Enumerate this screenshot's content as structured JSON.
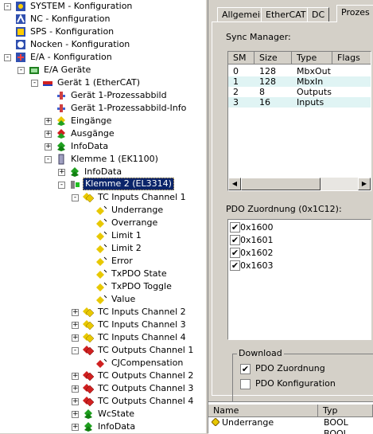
{
  "tree": [
    {
      "level": 0,
      "exp": "-",
      "icon": "system-icon",
      "label": "SYSTEM - Konfiguration"
    },
    {
      "level": 0,
      "exp": "",
      "icon": "nc-icon",
      "label": "NC - Konfiguration"
    },
    {
      "level": 0,
      "exp": "",
      "icon": "sps-icon",
      "label": "SPS - Konfiguration"
    },
    {
      "level": 0,
      "exp": "",
      "icon": "cam-icon",
      "label": "Nocken - Konfiguration"
    },
    {
      "level": 0,
      "exp": "-",
      "icon": "io-config-icon",
      "label": "E/A - Konfiguration"
    },
    {
      "level": 1,
      "exp": "-",
      "icon": "io-devices-icon",
      "label": "E/A Geräte"
    },
    {
      "level": 2,
      "exp": "-",
      "icon": "ethercat-device-icon",
      "label": "Gerät 1 (EtherCAT)"
    },
    {
      "level": 3,
      "exp": "",
      "icon": "process-image-icon",
      "label": "Gerät 1-Prozessabbild"
    },
    {
      "level": 3,
      "exp": "",
      "icon": "process-image-icon",
      "label": "Gerät 1-Prozessabbild-Info"
    },
    {
      "level": 3,
      "exp": "+",
      "icon": "inputs-icon",
      "label": "Eingänge"
    },
    {
      "level": 3,
      "exp": "+",
      "icon": "outputs-icon",
      "label": "Ausgänge"
    },
    {
      "level": 3,
      "exp": "+",
      "icon": "infodata-icon",
      "label": "InfoData"
    },
    {
      "level": 3,
      "exp": "-",
      "icon": "terminal-icon",
      "label": "Klemme 1 (EK1100)"
    },
    {
      "level": 4,
      "exp": "+",
      "icon": "infodata-icon",
      "label": "InfoData"
    },
    {
      "level": 4,
      "exp": "-",
      "icon": "module-icon",
      "label": "Klemme 2 (EL3314)",
      "selected": true
    },
    {
      "level": 5,
      "exp": "-",
      "icon": "input-var-icon",
      "label": "TC Inputs Channel 1"
    },
    {
      "level": 6,
      "exp": "",
      "icon": "var-in-icon",
      "label": "Underrange"
    },
    {
      "level": 6,
      "exp": "",
      "icon": "var-in-icon",
      "label": "Overrange"
    },
    {
      "level": 6,
      "exp": "",
      "icon": "var-in-icon",
      "label": "Limit 1"
    },
    {
      "level": 6,
      "exp": "",
      "icon": "var-in-icon",
      "label": "Limit 2"
    },
    {
      "level": 6,
      "exp": "",
      "icon": "var-in-icon",
      "label": "Error"
    },
    {
      "level": 6,
      "exp": "",
      "icon": "var-in-icon",
      "label": "TxPDO State"
    },
    {
      "level": 6,
      "exp": "",
      "icon": "var-in-icon",
      "label": "TxPDO Toggle"
    },
    {
      "level": 6,
      "exp": "",
      "icon": "var-in-icon",
      "label": "Value"
    },
    {
      "level": 5,
      "exp": "+",
      "icon": "input-var-icon",
      "label": "TC Inputs Channel 2"
    },
    {
      "level": 5,
      "exp": "+",
      "icon": "input-var-icon",
      "label": "TC Inputs Channel 3"
    },
    {
      "level": 5,
      "exp": "+",
      "icon": "input-var-icon",
      "label": "TC Inputs Channel 4"
    },
    {
      "level": 5,
      "exp": "-",
      "icon": "output-var-icon",
      "label": "TC Outputs Channel 1"
    },
    {
      "level": 6,
      "exp": "",
      "icon": "var-out-icon",
      "label": "CJCompensation"
    },
    {
      "level": 5,
      "exp": "+",
      "icon": "output-var-icon",
      "label": "TC Outputs Channel 2"
    },
    {
      "level": 5,
      "exp": "+",
      "icon": "output-var-icon",
      "label": "TC Outputs Channel 3"
    },
    {
      "level": 5,
      "exp": "+",
      "icon": "output-var-icon",
      "label": "TC Outputs Channel 4"
    },
    {
      "level": 5,
      "exp": "+",
      "icon": "infodata-icon",
      "label": "WcState"
    },
    {
      "level": 5,
      "exp": "+",
      "icon": "infodata-icon",
      "label": "InfoData"
    }
  ],
  "tabs": [
    "Allgemein",
    "EtherCAT",
    "DC",
    "Prozes"
  ],
  "sync_manager": {
    "label": "Sync Manager:",
    "columns": [
      "SM",
      "Size",
      "Type",
      "Flags"
    ],
    "rows": [
      [
        "0",
        "128",
        "MbxOut",
        ""
      ],
      [
        "1",
        "128",
        "MbxIn",
        ""
      ],
      [
        "2",
        "8",
        "Outputs",
        ""
      ],
      [
        "3",
        "16",
        "Inputs",
        ""
      ]
    ]
  },
  "pdo": {
    "label": "PDO Zuordnung (0x1C12):",
    "items": [
      {
        "label": "0x1600",
        "checked": true
      },
      {
        "label": "0x1601",
        "checked": true
      },
      {
        "label": "0x1602",
        "checked": true
      },
      {
        "label": "0x1603",
        "checked": true
      }
    ]
  },
  "download": {
    "title": "Download",
    "options": [
      {
        "label": "PDO Zuordnung",
        "checked": true
      },
      {
        "label": "PDO Konfiguration",
        "checked": false
      }
    ]
  },
  "bottom_list": {
    "columns": [
      "Name",
      "Typ"
    ],
    "rows": [
      [
        "Underrange",
        "BOOL"
      ],
      [
        "",
        "BOOL"
      ]
    ]
  },
  "colors": {
    "selection": "#0a246a",
    "row_highlight": "#e0f4f4",
    "window_bg": "#d4d0c8"
  }
}
